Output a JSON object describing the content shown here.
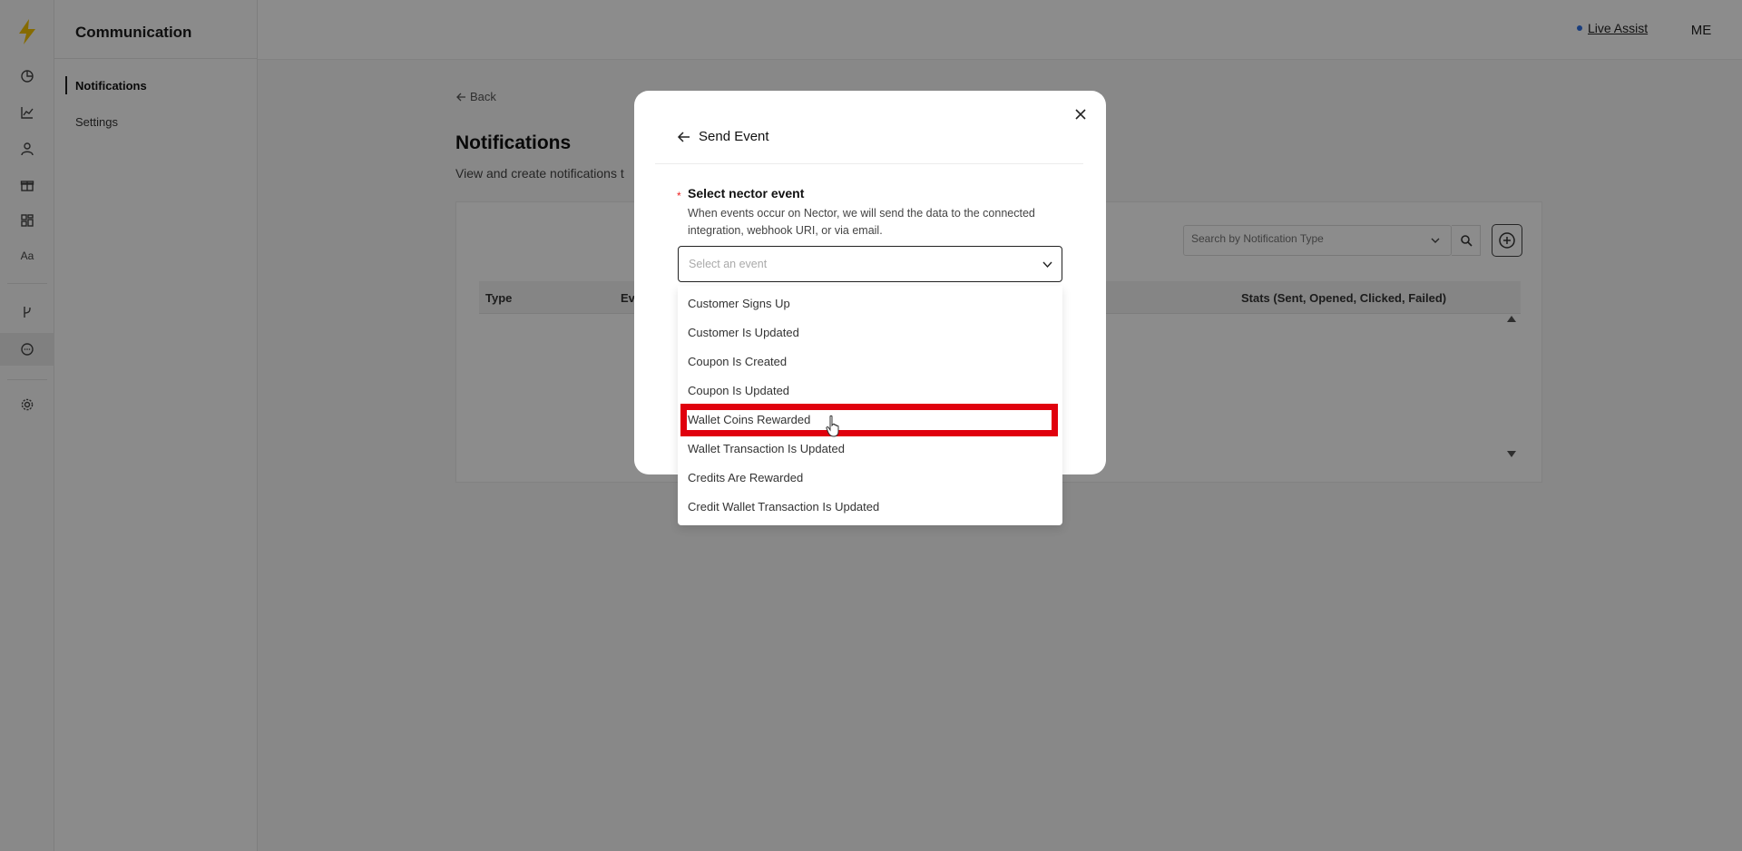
{
  "rail": {
    "icons": [
      "bolt-logo-icon",
      "pie-chart-icon",
      "line-chart-icon",
      "user-icon",
      "gift-icon",
      "layout-icon",
      "typography-icon",
      "git-branch-icon",
      "chat-icon",
      "gear-icon"
    ],
    "accent": "#f5c400",
    "typography_label": "Aa"
  },
  "subnav": {
    "title": "Communication",
    "items": [
      {
        "label": "Notifications",
        "active": true
      },
      {
        "label": "Settings",
        "active": false
      }
    ]
  },
  "topbar": {
    "live_assist": "Live Assist",
    "avatar": "ME"
  },
  "page": {
    "back": "Back",
    "title": "Notifications",
    "subtitle": "View and create notifications t"
  },
  "table": {
    "search_placeholder": "Search by Notification Type",
    "columns": [
      "Type",
      "Ev",
      "Stats (Sent, Opened, Clicked, Failed)"
    ]
  },
  "modal": {
    "title": "Send Event",
    "field_label": "Select nector event",
    "field_help": "When events occur on Nector, we will send the data to the connected integration, webhook URI, or via email.",
    "select_placeholder": "Select an event",
    "options": [
      "Customer Signs Up",
      "Customer Is Updated",
      "Coupon Is Created",
      "Coupon Is Updated",
      "Wallet Coins Rewarded",
      "Wallet Transaction Is Updated",
      "Credits Are Rewarded",
      "Credit Wallet Transaction Is Updated"
    ],
    "highlighted_option": "Wallet Coins Rewarded",
    "highlight_color": "#e0000d"
  }
}
